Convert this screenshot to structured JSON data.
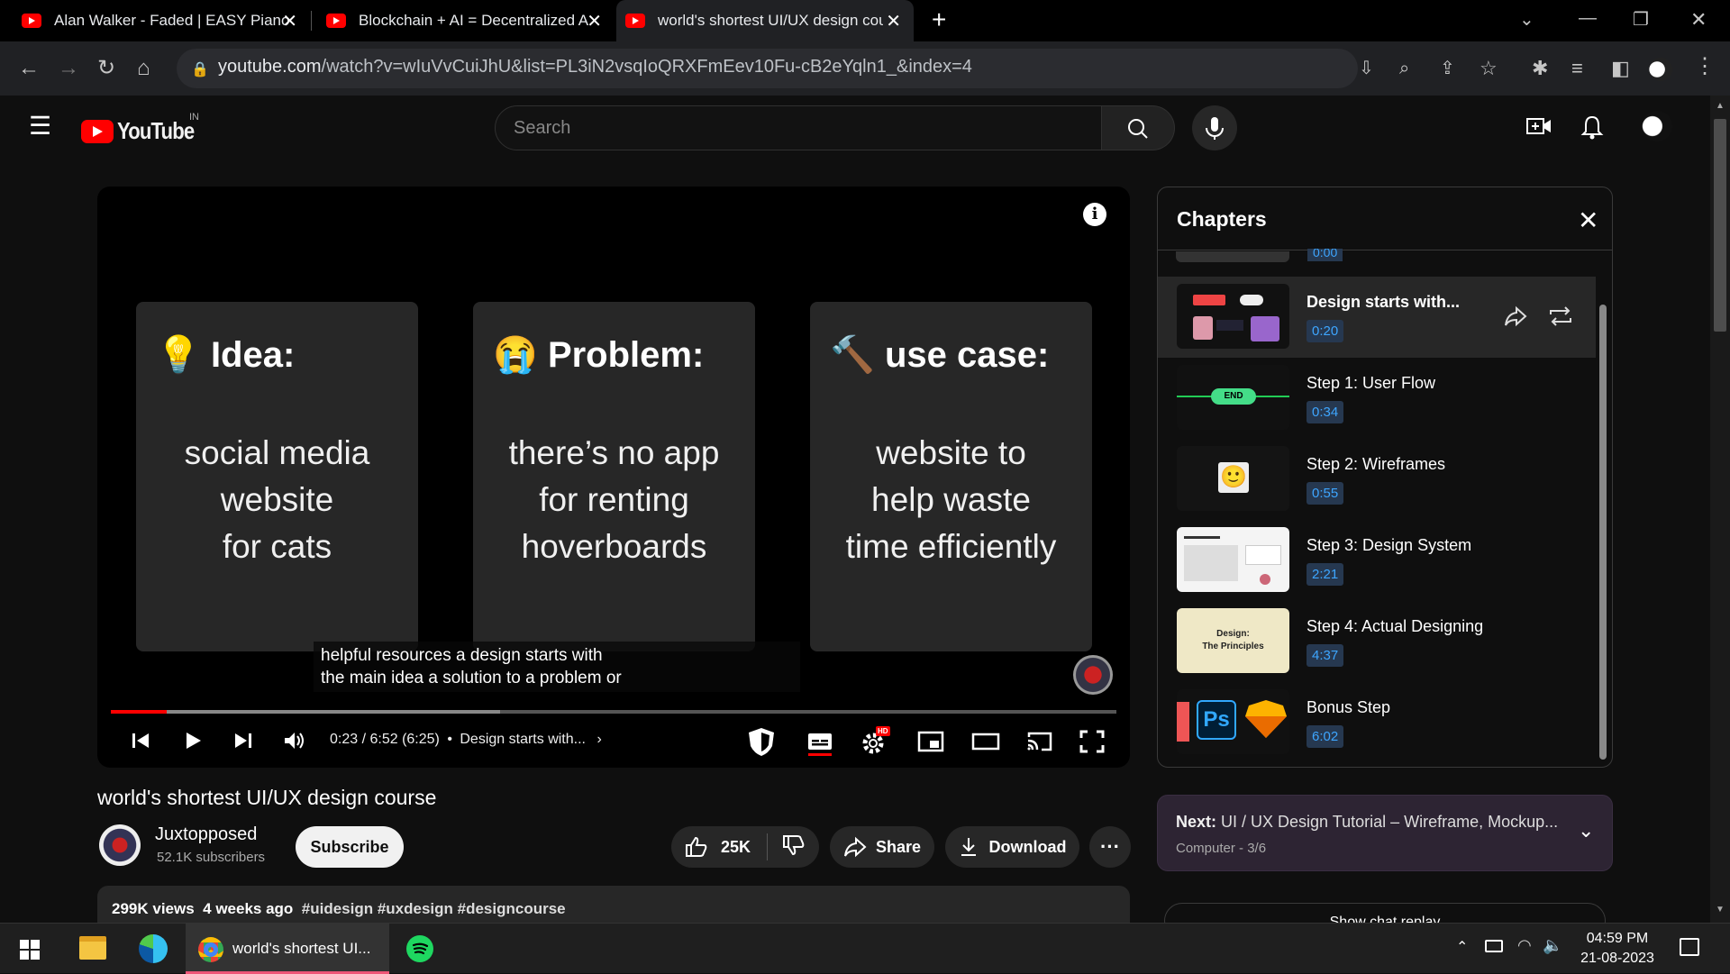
{
  "browser": {
    "tabs": [
      {
        "title": "Alan Walker - Faded | EASY Piano"
      },
      {
        "title": "Blockchain + AI = Decentralized A"
      },
      {
        "title": "world's shortest UI/UX design cou"
      }
    ],
    "url_domain": "youtube.com",
    "url_path": "/watch?v=wIuVvCuiJhU&list=PL3iN2vsqIoQRXFmEev10Fu-cB2eYqln1_&index=4"
  },
  "youtube": {
    "logo_text": "YouTube",
    "country": "IN",
    "search_placeholder": "Search"
  },
  "player": {
    "cards": [
      {
        "emoji": "💡",
        "heading": "Idea:",
        "lines": [
          "social media",
          "website",
          "for cats"
        ]
      },
      {
        "emoji": "😭",
        "heading": "Problem:",
        "lines": [
          "there’s no app",
          "for renting",
          "hoverboards"
        ]
      },
      {
        "emoji": "🔨",
        "heading": "use case:",
        "lines": [
          "website to",
          "help waste",
          "time efficiently"
        ]
      }
    ],
    "caption_line1": "helpful resources a design starts with",
    "caption_line2": "the main idea a solution to a problem or",
    "time": "0:23 / 6:52 (6:25)",
    "chapter": "Design starts with...",
    "progress_fraction": 0.056,
    "hd_badge": "HD"
  },
  "chapters": {
    "title": "Chapters",
    "partial_time": "0:00",
    "items": [
      {
        "title": "Design starts with...",
        "time": "0:20",
        "selected": true
      },
      {
        "title": "Step 1: User Flow",
        "time": "0:34",
        "thumb_text": "END"
      },
      {
        "title": "Step 2: Wireframes",
        "time": "0:55",
        "thumb_text": "🙂"
      },
      {
        "title": "Step 3: Design System",
        "time": "2:21"
      },
      {
        "title": "Step 4: Actual Designing",
        "time": "4:37",
        "thumb_text": "Design:\nThe Principles"
      },
      {
        "title": "Bonus Step",
        "time": "6:02",
        "thumb_text": "Ps"
      }
    ]
  },
  "video": {
    "title": "world's shortest UI/UX design course",
    "channel": "Juxtopposed",
    "subscribers": "52.1K subscribers",
    "subscribe_label": "Subscribe",
    "likes": "25K",
    "share_label": "Share",
    "download_label": "Download",
    "views": "299K views",
    "age": "4 weeks ago",
    "tags": "#uidesign #uxdesign #designcourse"
  },
  "next": {
    "label": "Next:",
    "title": "UI / UX Design Tutorial – Wireframe, Mockup...",
    "sub": "Computer - 3/6"
  },
  "partial_button": "Show chat replay",
  "taskbar": {
    "active_window": "world's shortest UI...",
    "time": "04:59 PM",
    "date": "21-08-2023"
  },
  "colors": {
    "accent": "#ff0000",
    "chapter_time": "#3ea6ff"
  }
}
